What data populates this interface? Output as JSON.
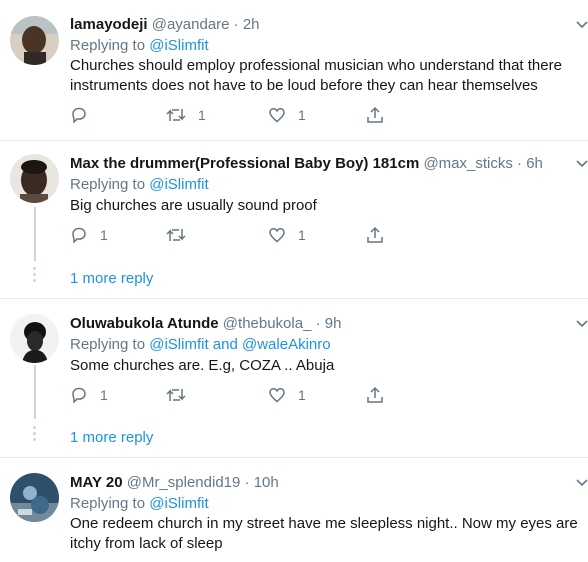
{
  "tweets": [
    {
      "name": "lamayodeji",
      "handle": "@ayandare",
      "sep": "·",
      "time": "2h",
      "replying_prefix": "Replying to",
      "replying_to": "@iSlimfit",
      "text": "Churches should employ professional musician who understand that there instruments does not have to be loud before they can hear themselves",
      "reply_count": "",
      "retweet_count": "1",
      "like_count": "1"
    },
    {
      "name": "Max the drummer(Professional Baby Boy) 181cm",
      "handle": "@max_sticks",
      "sep": "·",
      "time": "6h",
      "replying_prefix": "Replying to",
      "replying_to": "@iSlimfit",
      "text": "Big churches are usually sound proof",
      "reply_count": "1",
      "retweet_count": "",
      "like_count": "1",
      "more_reply": "1 more reply"
    },
    {
      "name": "Oluwabukola Atunde",
      "handle": "@thebukola_",
      "sep": "·",
      "time": "9h",
      "replying_prefix": "Replying to",
      "replying_to": "@iSlimfit",
      "replying_and": "and",
      "replying_to_2": "@waleAkinro",
      "text": "Some churches are. E.g, COZA .. Abuja",
      "reply_count": "1",
      "retweet_count": "",
      "like_count": "1",
      "more_reply": "1 more reply"
    },
    {
      "name": "MAY 20",
      "handle": "@Mr_splendid19",
      "sep": "·",
      "time": "10h",
      "replying_prefix": "Replying to",
      "replying_to": "@iSlimfit",
      "text": "One redeem church in my street have me sleepless night.. Now my eyes are itchy from lack of sleep"
    }
  ],
  "icons": {
    "reply": "reply-icon",
    "retweet": "retweet-icon",
    "like": "like-icon",
    "share": "share-icon",
    "more": "chevron-down-icon"
  },
  "colors": {
    "link": "#1b95e0",
    "secondary_text": "#657786",
    "divider": "#e6ecf0",
    "thread_line": "#ccd6dd"
  }
}
